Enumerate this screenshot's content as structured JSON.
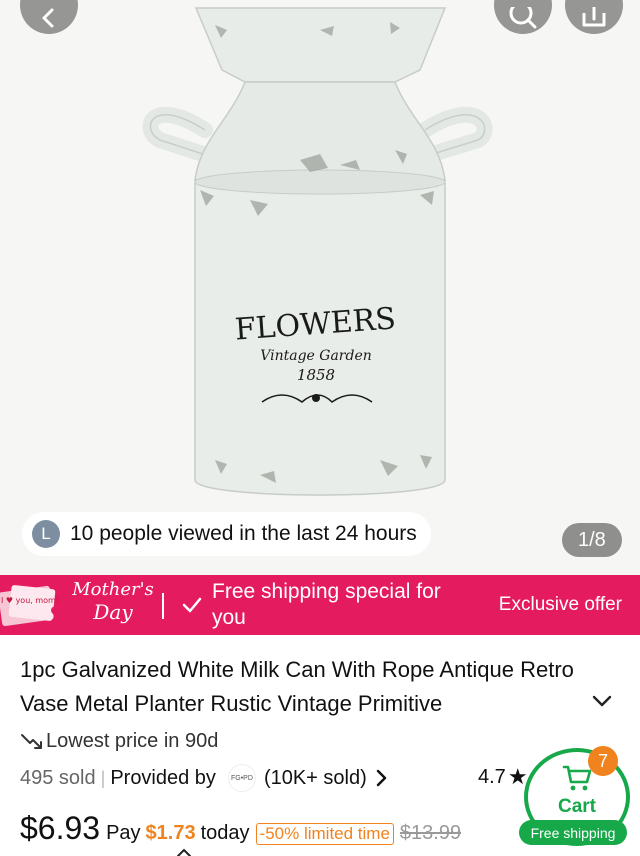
{
  "gallery": {
    "back_icon": "chevron-left-icon",
    "search_icon": "search-icon",
    "share_icon": "share-icon",
    "viewed_avatar_letter": "L",
    "viewed_text": "10 people viewed in the last 24 hours",
    "counter": "1/8",
    "product_print": {
      "line1": "FLOWERS",
      "line2": "Vintage Garden",
      "line3": "1858"
    }
  },
  "promo": {
    "card_text": "I ♥ you, mom!",
    "mothers_line1": "Mother's",
    "mothers_line2": "Day",
    "main_text": "Free shipping special for you",
    "exclusive": "Exclusive offer",
    "color": "#e41c5f"
  },
  "product": {
    "title": "1pc Galvanized White Milk Can With Rope Antique Retro Vase Metal Planter Rustic Vintage Primitive",
    "lowest_price": "Lowest price in 90d",
    "sold": "495 sold",
    "provided_by": "Provided by",
    "store_logo_text": "FG•PD",
    "store_sold": "(10K+ sold)",
    "rating": "4.7",
    "price": "$6.93",
    "pay_label": "Pay",
    "pay_amount": "$1.73",
    "today": "today",
    "discount": "-50% limited time",
    "original_price": "$13.99"
  },
  "cart": {
    "label": "Cart",
    "badge": "7",
    "free_shipping": "Free shipping",
    "accent": "#17a84a",
    "badge_color": "#f0831d"
  }
}
